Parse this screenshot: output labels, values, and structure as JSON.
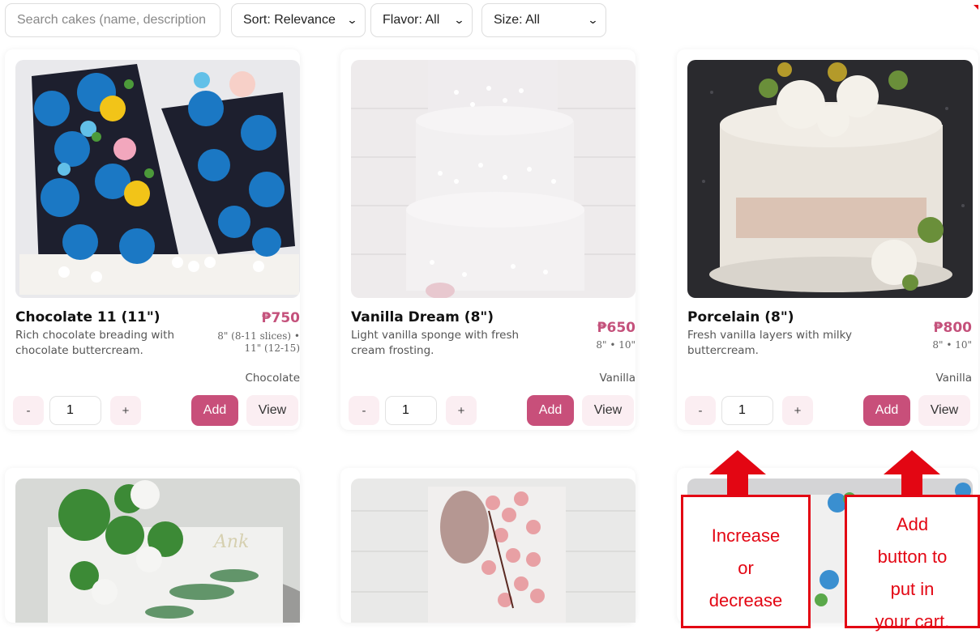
{
  "toolbar": {
    "search_placeholder": "Search cakes (name, description",
    "sort_label": "Sort: Relevance",
    "flavor_label": "Flavor: All",
    "size_label": "Size: All"
  },
  "products": [
    {
      "name": "Chocolate 11 (11\")",
      "description": "Rich chocolate breading with chocolate buttercream.",
      "price": "₱750",
      "sizes_line1": "8\" (8-11 slices) •",
      "sizes_line2": "11\" (12-15)",
      "flavor": "Chocolate",
      "quantity": "1",
      "minus_label": "-",
      "plus_label": "+",
      "add_label": "Add",
      "view_label": "View"
    },
    {
      "name": "Vanilla Dream (8\")",
      "description": "Light vanilla sponge with fresh cream frosting.",
      "price": "₱650",
      "sizes_line1": "8\" • 10\"",
      "flavor": "Vanilla",
      "quantity": "1",
      "minus_label": "-",
      "plus_label": "+",
      "add_label": "Add",
      "view_label": "View"
    },
    {
      "name": "Porcelain (8\")",
      "description": "Fresh vanilla layers with milky buttercream.",
      "price": "₱800",
      "sizes_line1": "8\" • 10\"",
      "flavor": "Vanilla",
      "quantity": "1",
      "minus_label": "-",
      "plus_label": "+",
      "add_label": "Add",
      "view_label": "View"
    }
  ],
  "annotations": {
    "quantity_note": [
      "Increase",
      "or",
      "decrease"
    ],
    "add_note": [
      "Add",
      "button to",
      "put in",
      "your cart."
    ]
  },
  "colors": {
    "accent": "#c84f7a",
    "price": "#c4517b",
    "annotation": "#e30613"
  }
}
